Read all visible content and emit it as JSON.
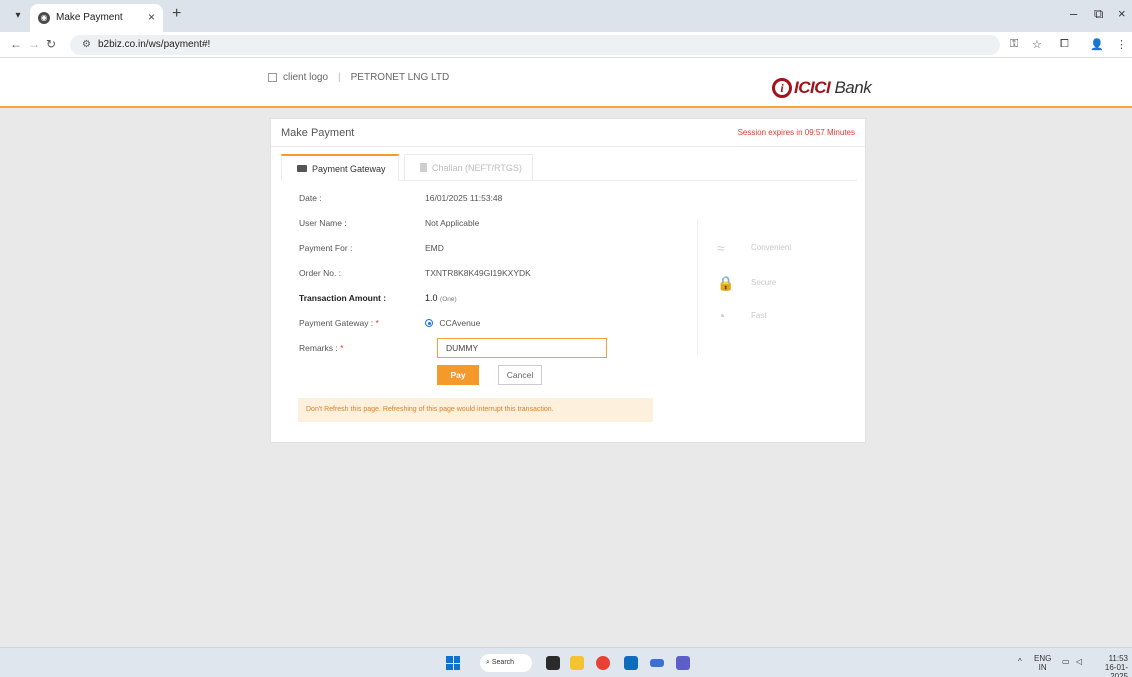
{
  "browser": {
    "tab_title": "Make Payment",
    "url": "b2biz.co.in/ws/payment#!"
  },
  "header": {
    "client_logo_alt": "client logo",
    "company": "PETRONET LNG LTD",
    "bank_name": "ICICI",
    "bank_suffix": "Bank"
  },
  "card": {
    "title": "Make Payment",
    "session": "Session expires in 09:57 Minutes",
    "tabs": [
      {
        "label": "Payment Gateway"
      },
      {
        "label": "Challan (NEFT/RTGS)"
      }
    ],
    "fields": [
      {
        "label": "Date :",
        "value": "16/01/2025 11:53:48"
      },
      {
        "label": "User Name :",
        "value": "Not Applicable"
      },
      {
        "label": "Payment For :",
        "value": "EMD"
      },
      {
        "label": "Order No. :",
        "value": "TXNTR8K8K49GI19KXYDK"
      },
      {
        "label": "Transaction Amount :",
        "value": "1.0",
        "value_words": "(One)"
      },
      {
        "label": "Payment Gateway :",
        "required": "*",
        "value": "CCAvenue"
      },
      {
        "label": "Remarks :",
        "required": "*",
        "value": "DUMMY"
      }
    ],
    "pay_label": "Pay",
    "cancel_label": "Cancel",
    "warning": "Don't Refresh this page. Refreshing of this page would interrupt this transaction.",
    "features": [
      {
        "label": "Convenient",
        "icon": "handshake-icon"
      },
      {
        "label": "Secure",
        "icon": "lock-icon"
      },
      {
        "label": "Fast",
        "icon": "speedometer-icon"
      }
    ]
  },
  "taskbar": {
    "search_label": "Search",
    "lang": "ENG",
    "region": "IN",
    "time": "11:53",
    "date": "16-01-2025"
  },
  "colors": {
    "accent": "#f39a2a",
    "bank_red": "#a6121a",
    "session_red": "#e23a2e",
    "warning_bg": "#fdf0dc"
  }
}
